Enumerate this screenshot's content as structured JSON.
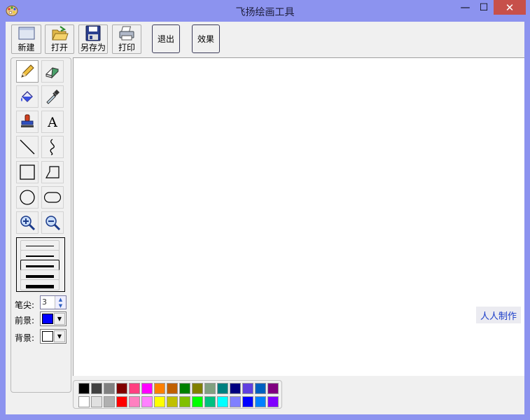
{
  "window": {
    "title": "飞扬绘画工具",
    "min_glyph": "—",
    "max_glyph": "☐",
    "close_glyph": "✕"
  },
  "toolbar": {
    "new_label": "新建",
    "open_label": "打开",
    "saveas_label": "另存为",
    "print_label": "打印",
    "exit_label": "退出",
    "effect_label": "效果"
  },
  "tools": [
    {
      "name": "pencil-icon",
      "active": true
    },
    {
      "name": "eraser-icon"
    },
    {
      "name": "paint-bucket-icon"
    },
    {
      "name": "eyedropper-icon"
    },
    {
      "name": "stamp-icon"
    },
    {
      "name": "text-icon",
      "glyph": "A"
    },
    {
      "name": "line-icon"
    },
    {
      "name": "curve-icon"
    },
    {
      "name": "rectangle-icon"
    },
    {
      "name": "polygon-icon"
    },
    {
      "name": "ellipse-icon"
    },
    {
      "name": "rounded-rect-icon"
    },
    {
      "name": "zoom-in-icon"
    },
    {
      "name": "zoom-out-icon"
    }
  ],
  "options": {
    "pen_tip_label": "笔尖:",
    "pen_tip_value": "3",
    "foreground_label": "前景:",
    "background_label": "背景:",
    "foreground_color": "#0000ff",
    "background_color": "#ffffff"
  },
  "canvas": {
    "credit_text": "人人制作"
  },
  "palette": {
    "row1": [
      "#000000",
      "#404040",
      "#808080",
      "#800000",
      "#ff4080",
      "#ff00ff",
      "#ff8000",
      "#c06000",
      "#008000",
      "#808000",
      "#80a080",
      "#008080",
      "#000080",
      "#6040e0",
      "#0060c0",
      "#800080"
    ],
    "row2": [
      "#ffffff",
      "#e0e0e0",
      "#b0b0b0",
      "#ff0000",
      "#ff80c0",
      "#ff80ff",
      "#ffff00",
      "#c0c000",
      "#80c000",
      "#00ff00",
      "#00c080",
      "#00ffff",
      "#8080ff",
      "#0000ff",
      "#0080ff",
      "#8000ff"
    ]
  }
}
